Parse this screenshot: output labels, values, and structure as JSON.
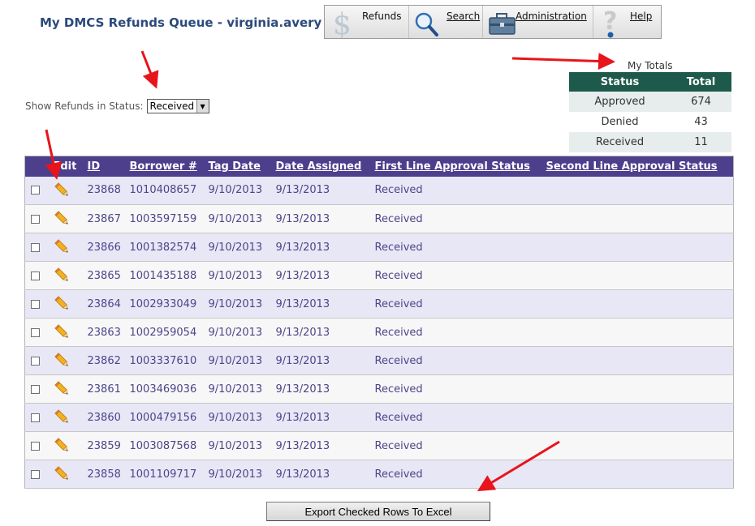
{
  "page": {
    "title": "My DMCS Refunds Queue - virginia.avery"
  },
  "toolbar": {
    "items": [
      {
        "label": "Refunds",
        "icon": "dollar-icon"
      },
      {
        "label": "Search",
        "icon": "magnifier-icon"
      },
      {
        "label": "Administration",
        "icon": "toolbox-icon"
      },
      {
        "label": "Help",
        "icon": "question-icon"
      }
    ]
  },
  "filter": {
    "label": "Show Refunds in Status:",
    "selected": "Received"
  },
  "totals": {
    "caption": "My Totals",
    "headers": [
      "Status",
      "Total"
    ],
    "rows": [
      {
        "status": "Approved",
        "total": "674"
      },
      {
        "status": "Denied",
        "total": "43"
      },
      {
        "status": "Received",
        "total": "11"
      }
    ]
  },
  "grid": {
    "headers": {
      "edit": "Edit",
      "id": "ID",
      "borrower": "Borrower #",
      "tag_date": "Tag Date",
      "date_assigned": "Date Assigned",
      "first_line": "First Line Approval Status",
      "second_line": "Second Line Approval Status"
    },
    "rows": [
      {
        "id": "23868",
        "borrower": "1010408657",
        "tag_date": "9/10/2013",
        "date_assigned": "9/13/2013",
        "first_line": "Received",
        "second_line": ""
      },
      {
        "id": "23867",
        "borrower": "1003597159",
        "tag_date": "9/10/2013",
        "date_assigned": "9/13/2013",
        "first_line": "Received",
        "second_line": ""
      },
      {
        "id": "23866",
        "borrower": "1001382574",
        "tag_date": "9/10/2013",
        "date_assigned": "9/13/2013",
        "first_line": "Received",
        "second_line": ""
      },
      {
        "id": "23865",
        "borrower": "1001435188",
        "tag_date": "9/10/2013",
        "date_assigned": "9/13/2013",
        "first_line": "Received",
        "second_line": ""
      },
      {
        "id": "23864",
        "borrower": "1002933049",
        "tag_date": "9/10/2013",
        "date_assigned": "9/13/2013",
        "first_line": "Received",
        "second_line": ""
      },
      {
        "id": "23863",
        "borrower": "1002959054",
        "tag_date": "9/10/2013",
        "date_assigned": "9/13/2013",
        "first_line": "Received",
        "second_line": ""
      },
      {
        "id": "23862",
        "borrower": "1003337610",
        "tag_date": "9/10/2013",
        "date_assigned": "9/13/2013",
        "first_line": "Received",
        "second_line": ""
      },
      {
        "id": "23861",
        "borrower": "1003469036",
        "tag_date": "9/10/2013",
        "date_assigned": "9/13/2013",
        "first_line": "Received",
        "second_line": ""
      },
      {
        "id": "23860",
        "borrower": "1000479156",
        "tag_date": "9/10/2013",
        "date_assigned": "9/13/2013",
        "first_line": "Received",
        "second_line": ""
      },
      {
        "id": "23859",
        "borrower": "1003087568",
        "tag_date": "9/10/2013",
        "date_assigned": "9/13/2013",
        "first_line": "Received",
        "second_line": ""
      },
      {
        "id": "23858",
        "borrower": "1001109717",
        "tag_date": "9/10/2013",
        "date_assigned": "9/13/2013",
        "first_line": "Received",
        "second_line": ""
      }
    ]
  },
  "export": {
    "label": "Export Checked Rows To Excel"
  },
  "colors": {
    "title": "#2b4a7c",
    "grid_header": "#4d3f8c",
    "totals_header": "#1d5a4b",
    "row_text": "#4b4589",
    "annotation_arrow": "#e8141b"
  }
}
